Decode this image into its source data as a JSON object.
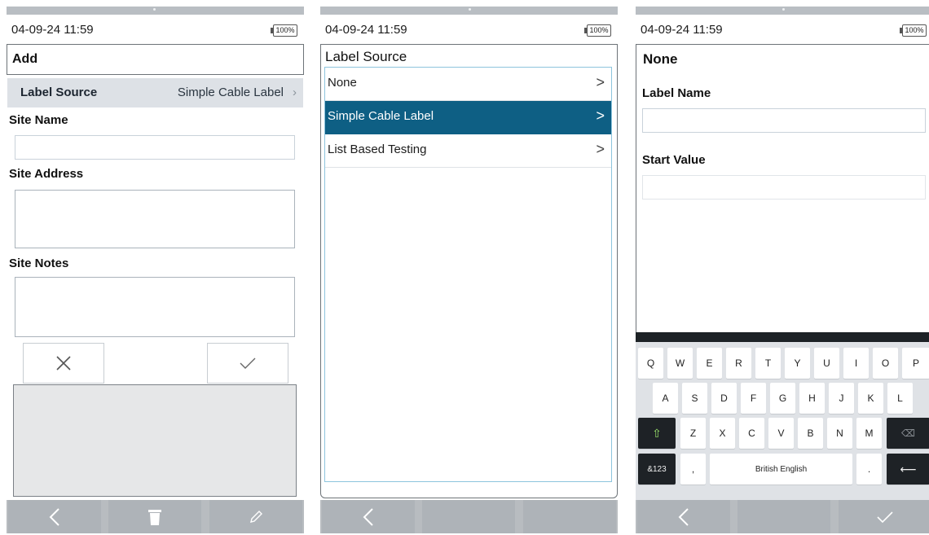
{
  "status": {
    "datetime": "04-09-24 11:59",
    "battery": "100%"
  },
  "screen1": {
    "title": "Add",
    "label_source": {
      "label": "Label Source",
      "value": "Simple Cable Label",
      "chevron": "›"
    },
    "site_name_label": "Site Name",
    "site_address_label": "Site Address",
    "site_notes_label": "Site Notes",
    "cancel_icon": "close-icon",
    "confirm_icon": "check-icon",
    "bottom_icons": [
      "back-icon",
      "trash-icon",
      "pencil-icon"
    ]
  },
  "screen2": {
    "title": "Label Source",
    "items": [
      {
        "label": "None",
        "chevron": ">"
      },
      {
        "label": "Simple Cable Label",
        "chevron": ">"
      },
      {
        "label": "List Based Testing",
        "chevron": ">"
      }
    ],
    "selected_index": 1,
    "bottom_icons": [
      "back-icon",
      "",
      ""
    ]
  },
  "screen3": {
    "title": "None",
    "label_name_label": "Label Name",
    "start_value_label": "Start Value",
    "keyboard": {
      "row1": [
        "Q",
        "W",
        "E",
        "R",
        "T",
        "Y",
        "U",
        "I",
        "O",
        "P"
      ],
      "row2": [
        "A",
        "S",
        "D",
        "F",
        "G",
        "H",
        "J",
        "K",
        "L"
      ],
      "row3": [
        "Z",
        "X",
        "C",
        "V",
        "B",
        "N",
        "M"
      ],
      "shift": "⇧",
      "backspace": "⌫",
      "sym": "&123",
      "comma": ",",
      "space": "British English",
      "period": ".",
      "enter": "⟵"
    },
    "bottom_icons": [
      "back-icon",
      "",
      "check-icon"
    ]
  },
  "colors": {
    "selected_row": "#0e5f84",
    "bottom_bar": "#b8bcc0",
    "keyboard_bg": "#dfe2e6",
    "shift_glyph": "#9be36b"
  }
}
